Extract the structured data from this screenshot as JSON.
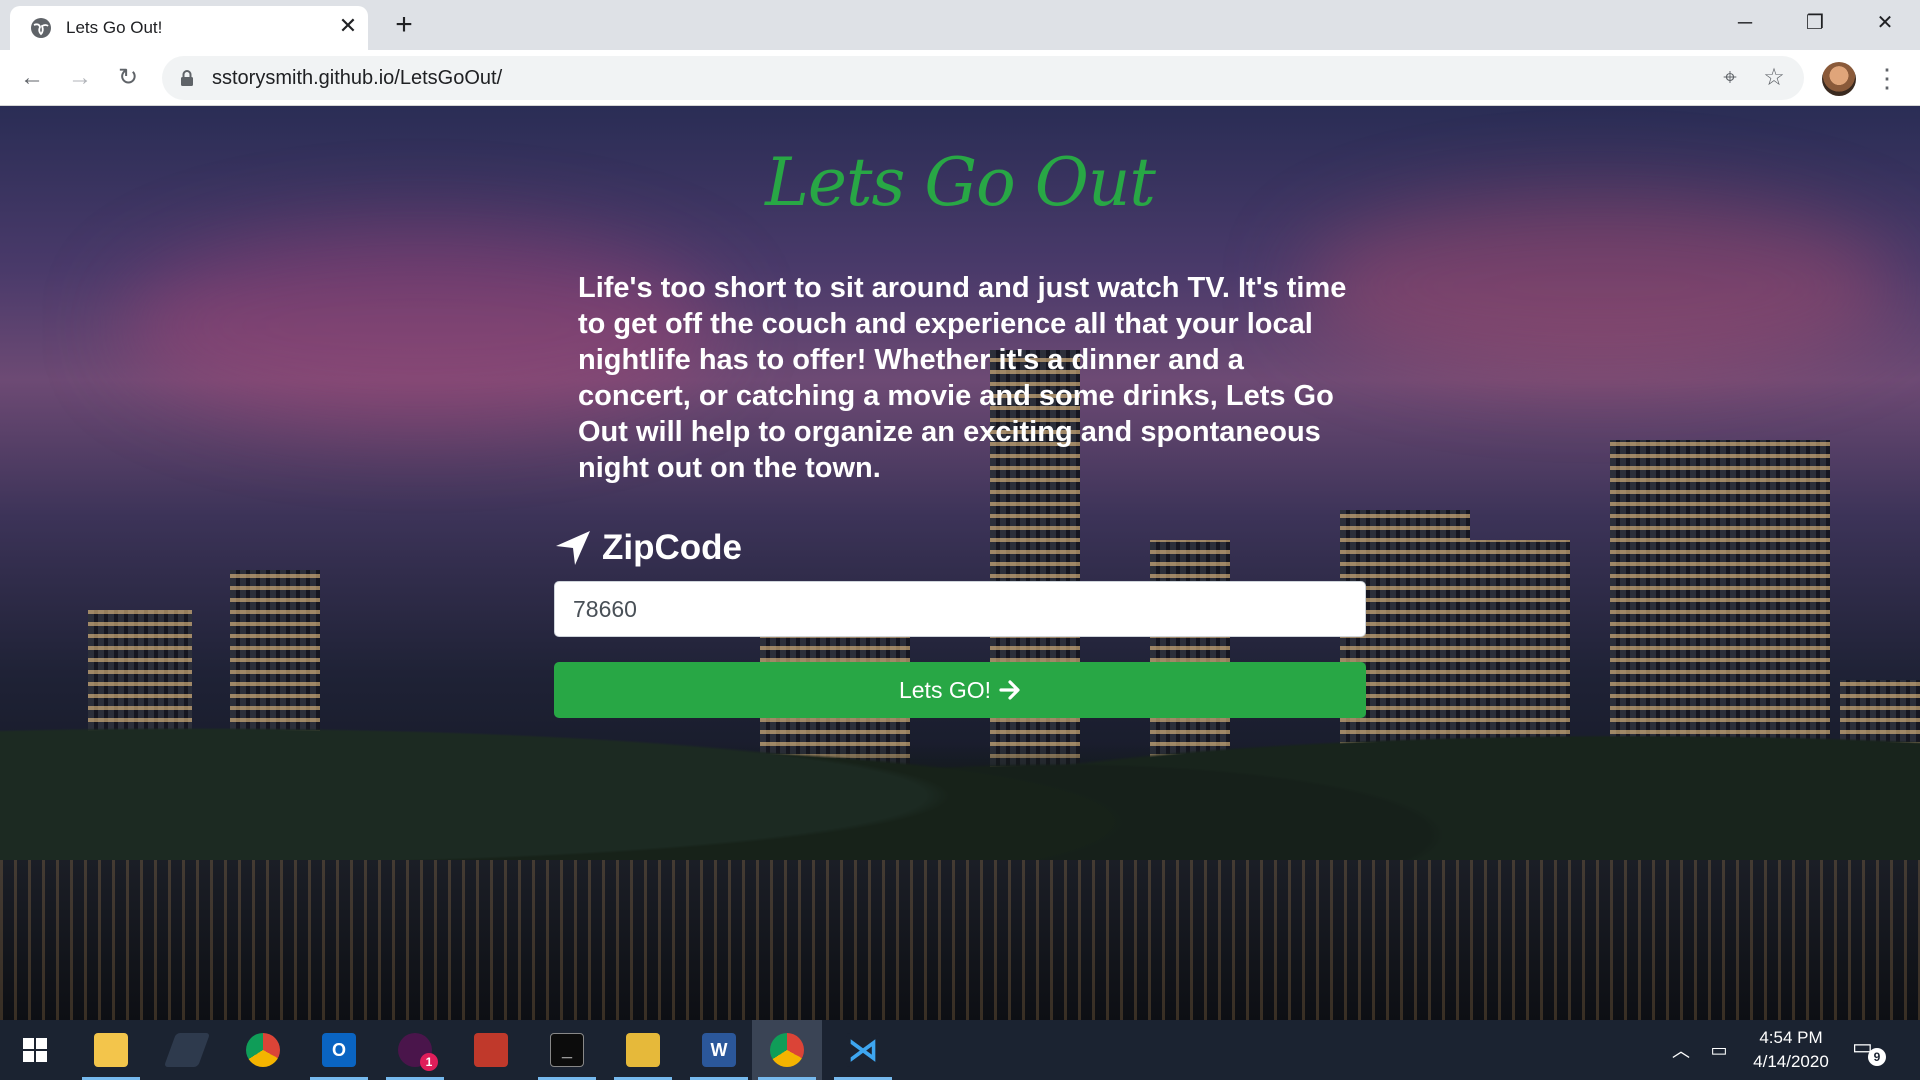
{
  "browser": {
    "tab_title": "Lets Go Out!",
    "url": "sstorysmith.github.io/LetsGoOut/"
  },
  "page": {
    "title": "Lets Go Out",
    "intro": "Life's too short to sit around and just watch TV. It's time to get off the couch and experience all that your local nightlife has to offer! Whether it's a dinner and a concert, or catching a movie and some drinks, Lets Go Out will help to organize an exciting and spontaneous night out on the town.",
    "zip_label": "ZipCode",
    "zip_value": "78660",
    "go_button": "Lets GO!",
    "accent_color": "#28a745"
  },
  "taskbar": {
    "time": "4:54 PM",
    "date": "4/14/2020",
    "notification_count": "9",
    "slack_badge": "1",
    "apps": [
      "windows-start",
      "file-explorer",
      "photo-app",
      "chrome",
      "outlook",
      "slack",
      "app-red",
      "terminal",
      "archive",
      "word",
      "chrome-active",
      "vscode"
    ]
  }
}
